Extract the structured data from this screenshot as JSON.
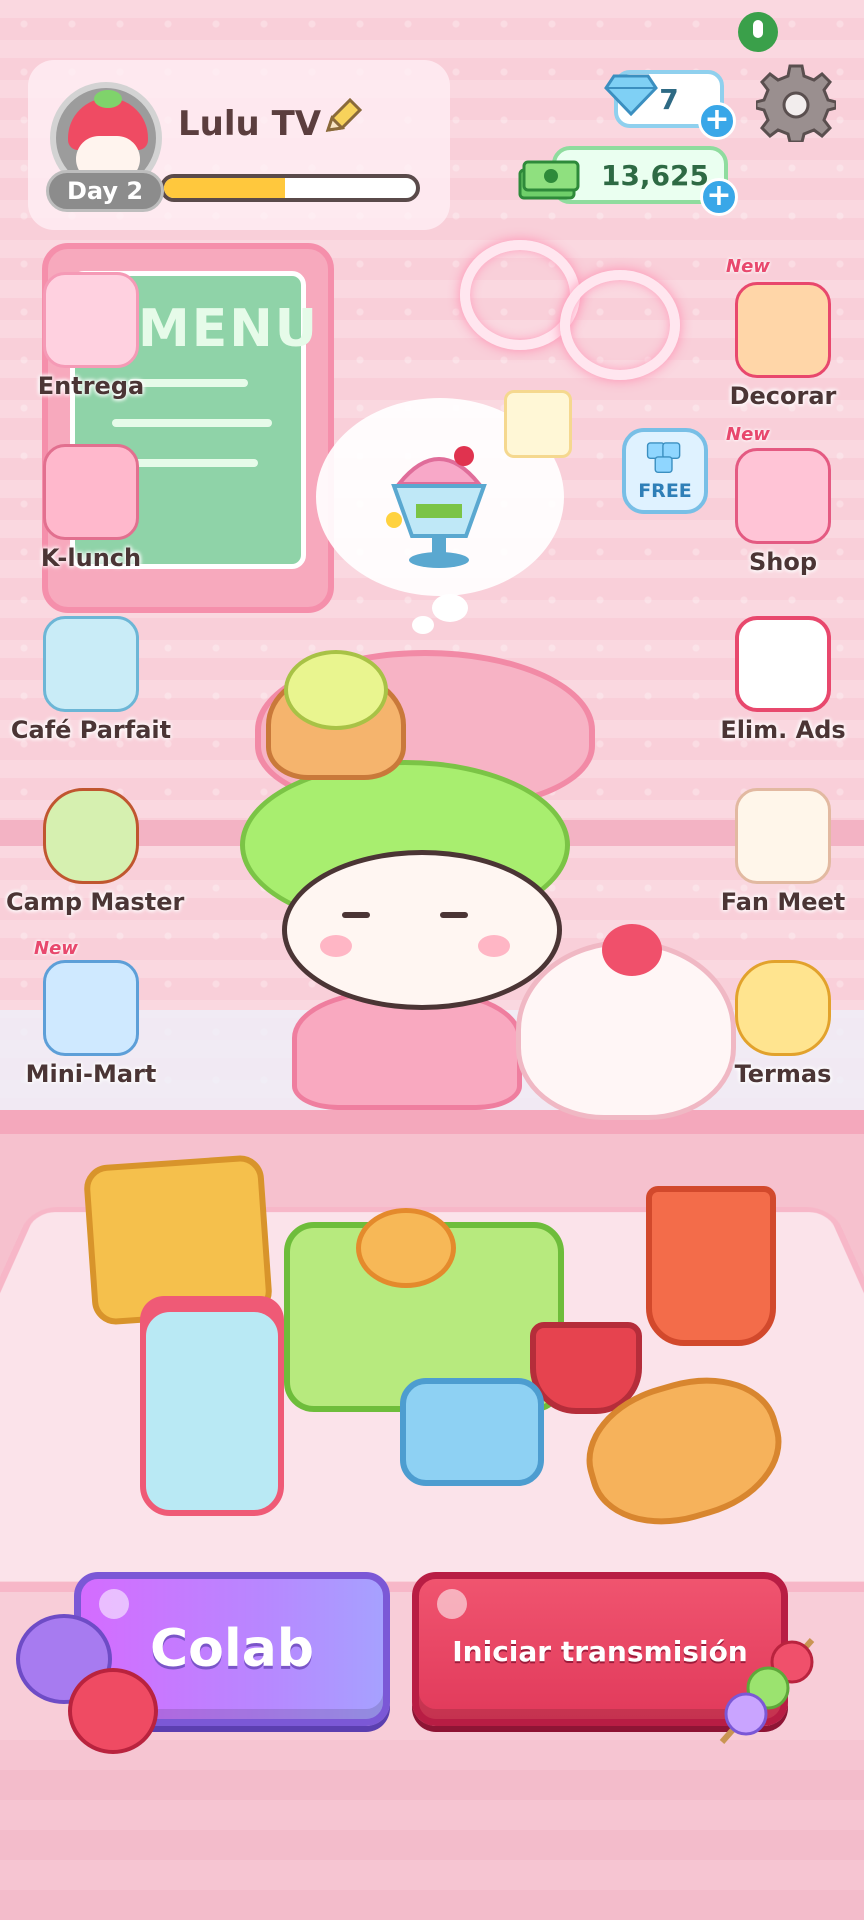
{
  "player": {
    "name": "Lulu TV",
    "day": "Day 2",
    "day_progress": 0.48
  },
  "currency": {
    "gems": "7",
    "cash": "13,625"
  },
  "left_menu": [
    {
      "label": "Entrega",
      "icon": "delivery-icon",
      "new": false
    },
    {
      "label": "K-lunch",
      "icon": "k-lunch-icon",
      "new": false
    },
    {
      "label": "Café Parfait",
      "icon": "parfait-icon",
      "new": false
    },
    {
      "label": "Camp Master",
      "icon": "skewer-icon",
      "new": false
    },
    {
      "label": "Mini-Mart",
      "icon": "mini-mart-icon",
      "new": true
    }
  ],
  "right_menu": [
    {
      "label": "Decorar",
      "icon": "decorate-icon",
      "new": true
    },
    {
      "label": "Shop",
      "icon": "shop-icon",
      "new": true
    },
    {
      "label": "Elim. Ads",
      "icon": "no-ads-icon",
      "new": false
    },
    {
      "label": "Fan Meet",
      "icon": "fan-meet-icon",
      "new": false
    },
    {
      "label": "Termas",
      "icon": "hot-spring-icon",
      "new": false
    }
  ],
  "badges": {
    "new_text": "New",
    "free_text": "FREE"
  },
  "scene": {
    "menu_board_title": "MENU"
  },
  "buttons": {
    "colab": "Colab",
    "start_stream": "Iniciar transmisión"
  },
  "colors": {
    "background": "#f9d3dd",
    "colab_button": "#c27bff",
    "stream_button": "#e8456a",
    "progress_fill": "#ffc83d",
    "label_text": "#4b3535"
  }
}
